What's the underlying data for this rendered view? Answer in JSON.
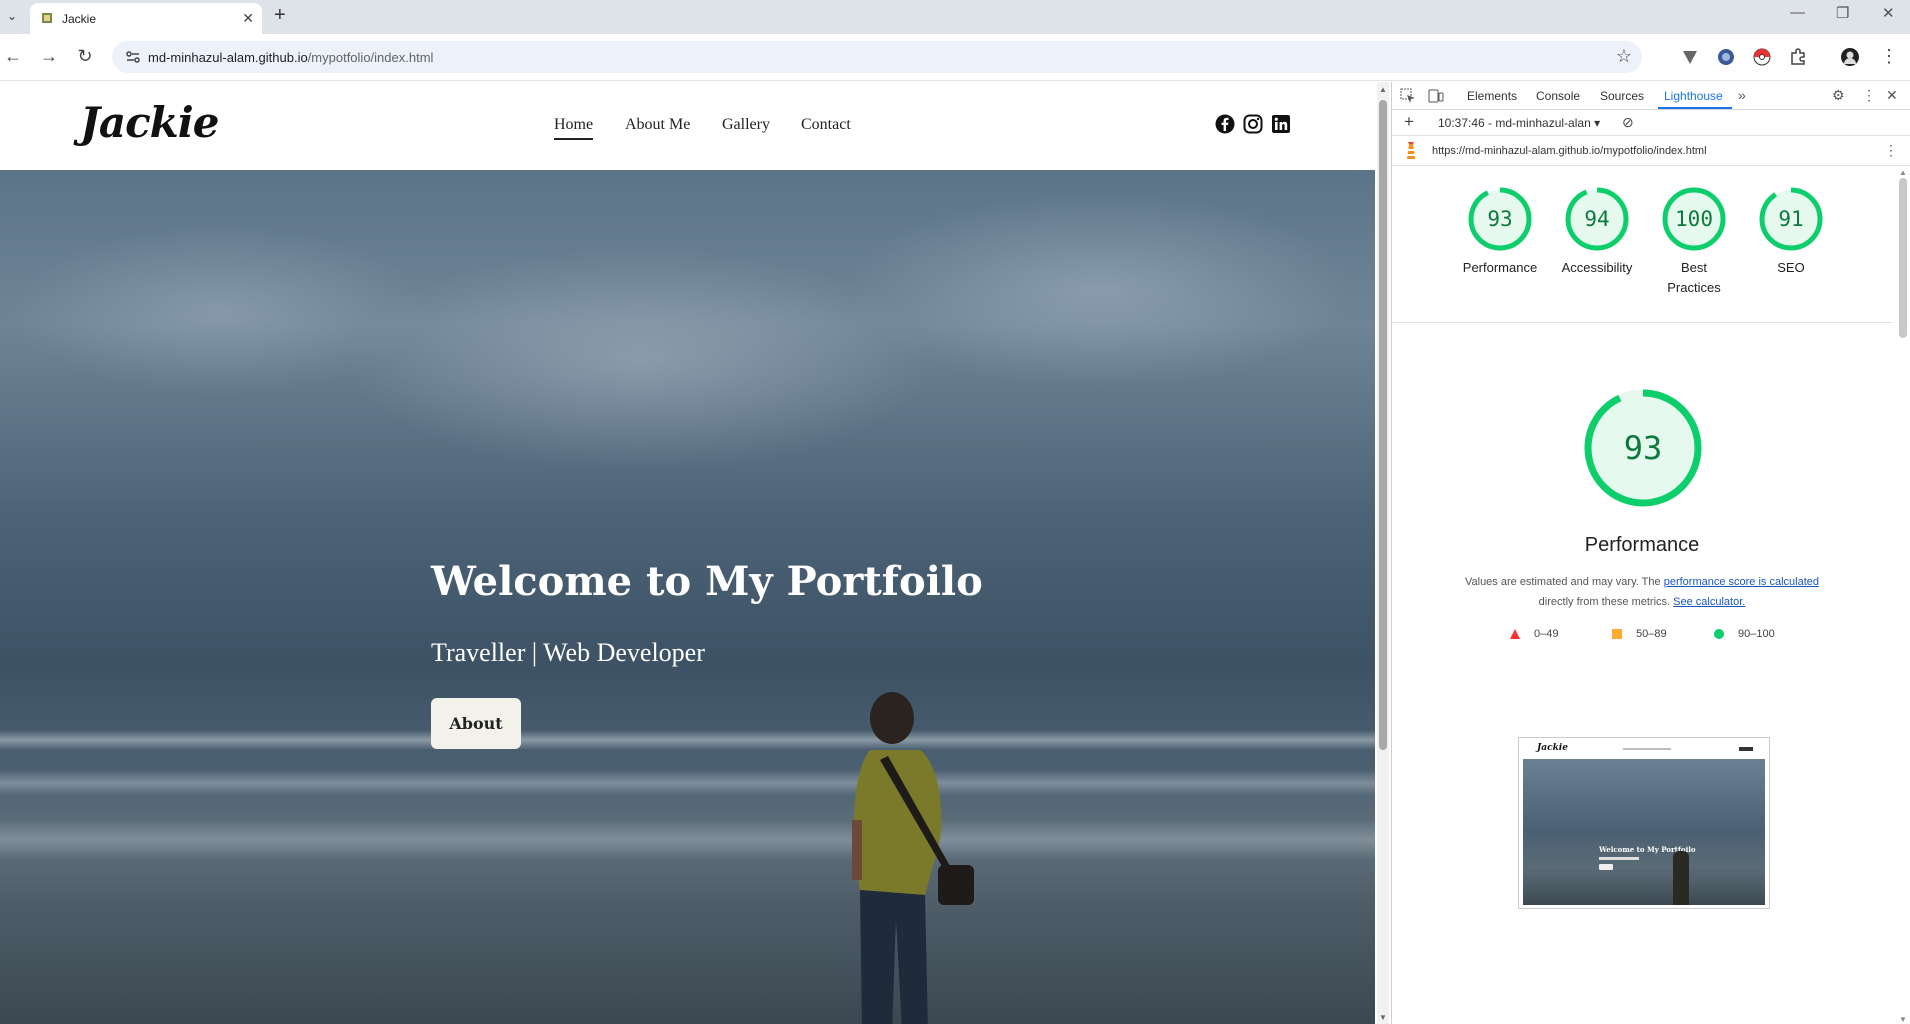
{
  "browser": {
    "tab_title": "Jackie",
    "url_host": "md-minhazul-alam.github.io",
    "url_path": "/mypotfolio/index.html",
    "tab_list_icon": "chevron-down-icon",
    "new_tab_icon": "plus-icon",
    "window_controls": [
      "minimize-icon",
      "restore-icon",
      "close-icon"
    ]
  },
  "site": {
    "logo": "Jackie",
    "nav": [
      "Home",
      "About Me",
      "Gallery",
      "Contact"
    ],
    "active_nav": "Home",
    "social": [
      "facebook-icon",
      "instagram-icon",
      "linkedin-icon"
    ],
    "hero": {
      "title": "Welcome to My Portfoilo",
      "subtitle": "Traveller | Web Developer",
      "button": "About"
    }
  },
  "devtools": {
    "tabs": [
      "Elements",
      "Console",
      "Sources",
      "Lighthouse"
    ],
    "active_tab": "Lighthouse",
    "overflow": "»",
    "report_selector": "10:37:46 - md-minhazul-alan",
    "audited_url": "https://md-minhazul-alam.github.io/mypotfolio/index.html",
    "scores": [
      {
        "label": "Performance",
        "value": 93
      },
      {
        "label": "Accessibility",
        "value": 94
      },
      {
        "label": "Best Practices",
        "value": 100
      },
      {
        "label": "SEO",
        "value": 91
      }
    ],
    "main_score": {
      "label": "Performance",
      "value": 93
    },
    "description": {
      "part1": "Values are estimated and may vary. The ",
      "link1": "performance score is calculated",
      "part2": " directly from these metrics. ",
      "link2": "See calculator."
    },
    "legend": [
      {
        "range": "0–49",
        "shape": "triangle",
        "color": "#ff3333"
      },
      {
        "range": "50–89",
        "shape": "square",
        "color": "#ffaa33"
      },
      {
        "range": "90–100",
        "shape": "circle",
        "color": "#0cce6b"
      }
    ],
    "thumbnail": {
      "title": "Welcome to My Portfoilo"
    },
    "colors": {
      "pass": "#0cce6b",
      "pass_bg": "#e6f9ee",
      "pass_text": "#0c7a3d",
      "accent": "#1a73e8"
    }
  }
}
